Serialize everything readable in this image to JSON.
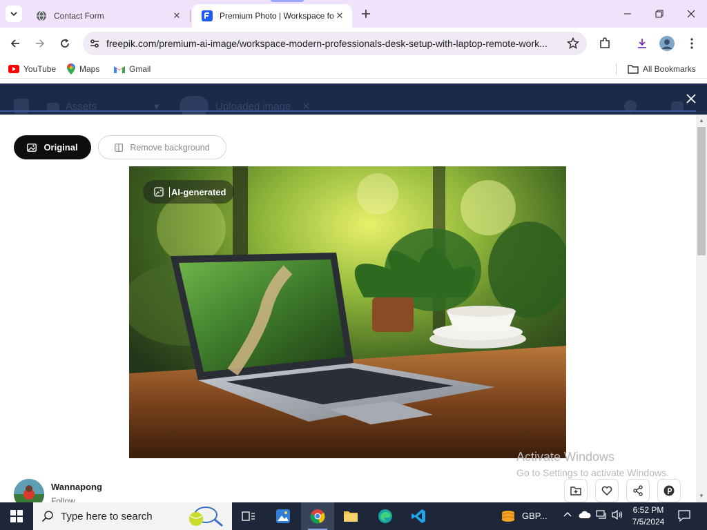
{
  "browser": {
    "tabs": [
      {
        "title": "Contact Form",
        "favicon": "globe-icon",
        "active": false
      },
      {
        "title": "Premium Photo | Workspace for",
        "favicon": "freepik-icon",
        "active": true
      }
    ],
    "url": "freepik.com/premium-ai-image/workspace-modern-professionals-desk-setup-with-laptop-remote-work...",
    "bookmarks": [
      {
        "label": "YouTube",
        "icon": "youtube-icon"
      },
      {
        "label": "Maps",
        "icon": "maps-icon"
      },
      {
        "label": "Gmail",
        "icon": "gmail-icon"
      }
    ],
    "all_bookmarks": "All Bookmarks"
  },
  "background_nav": {
    "assets": "Assets",
    "uploaded": "Uploaded image"
  },
  "modal": {
    "tabs": {
      "original": "Original",
      "remove_bg": "Remove background"
    },
    "image_badge": "AI-generated",
    "author": {
      "name": "Wannapong",
      "follow": "Follow"
    },
    "actions": [
      "add-to-collection-icon",
      "heart-icon",
      "share-icon",
      "pinterest-icon"
    ]
  },
  "watermark": {
    "line1": "Activate Windows",
    "line2": "Go to Settings to activate Windows."
  },
  "taskbar": {
    "search_placeholder": "Type here to search",
    "currency": "GBP...",
    "time": "6:52 PM",
    "date": "7/5/2024"
  },
  "colors": {
    "tabstrip": "#f0e2fb",
    "freepik_header": "#1c2a49",
    "primary_button": "#0e0e0e",
    "taskbar": "#1d2739"
  }
}
